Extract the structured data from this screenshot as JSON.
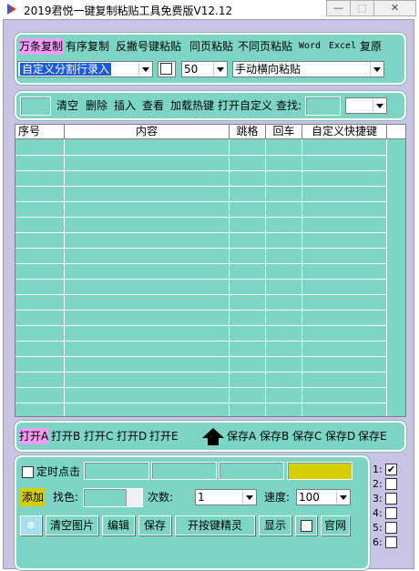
{
  "window": {
    "title": "2019君悦一键复制粘贴工具免费版V12.12",
    "min_symbol": "—",
    "max_symbol": "□",
    "close_symbol": "✕"
  },
  "top_panel": {
    "modes": [
      "万条复制",
      "有序复制",
      "反撇号键粘贴",
      "同页粘贴",
      "不同页粘贴",
      "Word",
      "Excel",
      "复原"
    ],
    "split_mode": "自定义分割行录入",
    "count": "50",
    "paste_mode": "手动横向粘贴"
  },
  "toolbar": {
    "clear": "清空",
    "delete": "删除",
    "insert": "插入",
    "view": "查看",
    "load_hotkey": "加载热键",
    "open_custom": "打开自定义",
    "search_label": "查找:",
    "search_value": ""
  },
  "grid": {
    "columns": [
      "序号",
      "内容",
      "跳格",
      "回车",
      "自定义快捷键"
    ],
    "rows": []
  },
  "file_bar": {
    "open": [
      "打开A",
      "打开B",
      "打开C",
      "打开D",
      "打开E"
    ],
    "save": [
      "保存A",
      "保存B",
      "保存C",
      "保存D",
      "保存E"
    ]
  },
  "bottom_panel": {
    "timer_label": "定时点击",
    "add": "添加",
    "find_color_label": "找色:",
    "times_label": "次数:",
    "times_value": "1",
    "speed_label": "速度:",
    "speed_value": "100",
    "snowflake_symbol": "❄",
    "clear_images": "清空图片",
    "edit": "编辑",
    "save": "保存",
    "open_sprite": "开按键精灵",
    "show": "显示",
    "website": "官网"
  },
  "slots": {
    "labels": [
      "1:",
      "2:",
      "3:",
      "4:",
      "5:",
      "6:"
    ],
    "checked_mark": "✔"
  },
  "colors": {
    "panel": "#7dd6c5",
    "frame": "#c9c4e6",
    "highlight_pink": "#f29df5",
    "yellow_field": "#d6cf00",
    "selection_blue": "#1e5bd6"
  }
}
